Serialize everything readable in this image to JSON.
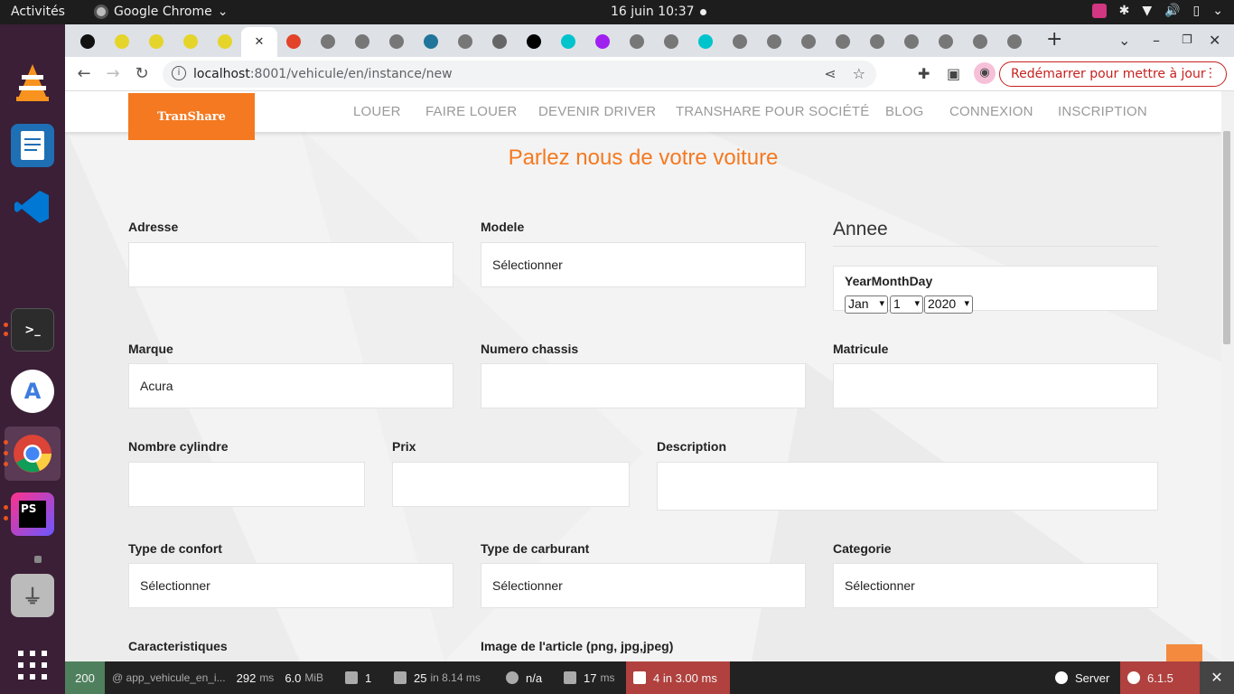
{
  "system": {
    "activities": "Activités",
    "app_name": "Google Chrome",
    "clock": "16 juin  10:37"
  },
  "browser": {
    "url_host": "localhost",
    "url_rest": ":8001/vehicule/en/instance/new",
    "restart_label": "Redémarrer pour mettre à jour",
    "tab_favicons": [
      "threads-icon",
      "yellow-face-icon",
      "yellow-face-icon",
      "yellow-face-icon",
      "yellow-face-icon",
      "active-tab",
      "gitlab-icon",
      "globe-icon",
      "globe-icon",
      "globe-icon",
      "wordpress-icon",
      "globe-icon",
      "car-icon",
      "upwork-icon",
      "canva-icon",
      "bot-icon",
      "globe-icon",
      "globe-icon",
      "canva-icon",
      "globe-icon",
      "globe-icon",
      "globe-icon",
      "globe-icon",
      "globe-icon",
      "globe-icon",
      "globe-icon",
      "globe-icon",
      "globe-icon"
    ]
  },
  "site": {
    "brand": "TranShare",
    "nav": [
      "LOUER",
      "FAIRE LOUER",
      "DEVENIR DRIVER",
      "TRANSHARE POUR SOCIÉTÉ",
      "BLOG",
      "CONNEXION",
      "INSCRIPTION"
    ],
    "form_title": "Parlez nous de votre voiture",
    "fields": {
      "adresse": {
        "label": "Adresse",
        "value": ""
      },
      "modele": {
        "label": "Modele",
        "value": "Sélectionner"
      },
      "annee": {
        "title": "Annee",
        "sublabel": "YearMonthDay",
        "month": "Jan",
        "day": "1",
        "year": "2020"
      },
      "marque": {
        "label": "Marque",
        "value": "Acura"
      },
      "numero_chassis": {
        "label": "Numero chassis",
        "value": ""
      },
      "matricule": {
        "label": "Matricule",
        "value": ""
      },
      "nombre_cylindre": {
        "label": "Nombre cylindre",
        "value": ""
      },
      "prix": {
        "label": "Prix",
        "value": ""
      },
      "description": {
        "label": "Description",
        "value": ""
      },
      "type_confort": {
        "label": "Type de confort",
        "value": "Sélectionner"
      },
      "type_carburant": {
        "label": "Type de carburant",
        "value": "Sélectionner"
      },
      "categorie": {
        "label": "Categorie",
        "value": "Sélectionner"
      },
      "caracteristiques": {
        "label": "Caracteristiques"
      },
      "image": {
        "label": "Image de l'article (png, jpg,jpeg)"
      }
    }
  },
  "profiler": {
    "status": "200",
    "route": "@ app_vehicule_en_i...",
    "time": "292",
    "time_unit": "ms",
    "memory": "6.0",
    "memory_unit": "MiB",
    "forms": "1",
    "cache": "25",
    "cache_suffix": "in 8.14 ms",
    "user": "n/a",
    "events_time": "17",
    "events_unit": "ms",
    "db": "4 in 3.00 ms",
    "server": "Server",
    "version": "6.1.5"
  }
}
